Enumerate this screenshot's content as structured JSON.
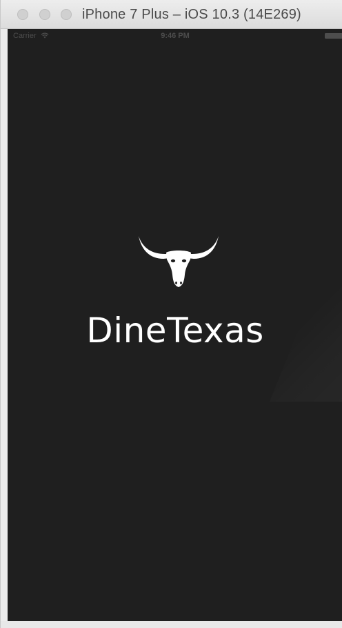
{
  "window": {
    "title": "iPhone 7 Plus – iOS 10.3 (14E269)"
  },
  "statusbar": {
    "carrier": "Carrier",
    "time": "9:46 PM",
    "icons": [
      "wifi-icon",
      "battery-icon"
    ]
  },
  "splash": {
    "logo_icon": "longhorn-skull-icon",
    "app_name": "DineTexas"
  },
  "colors": {
    "screen_background": "#1f1f1f",
    "logo_text": "#ffffff"
  }
}
